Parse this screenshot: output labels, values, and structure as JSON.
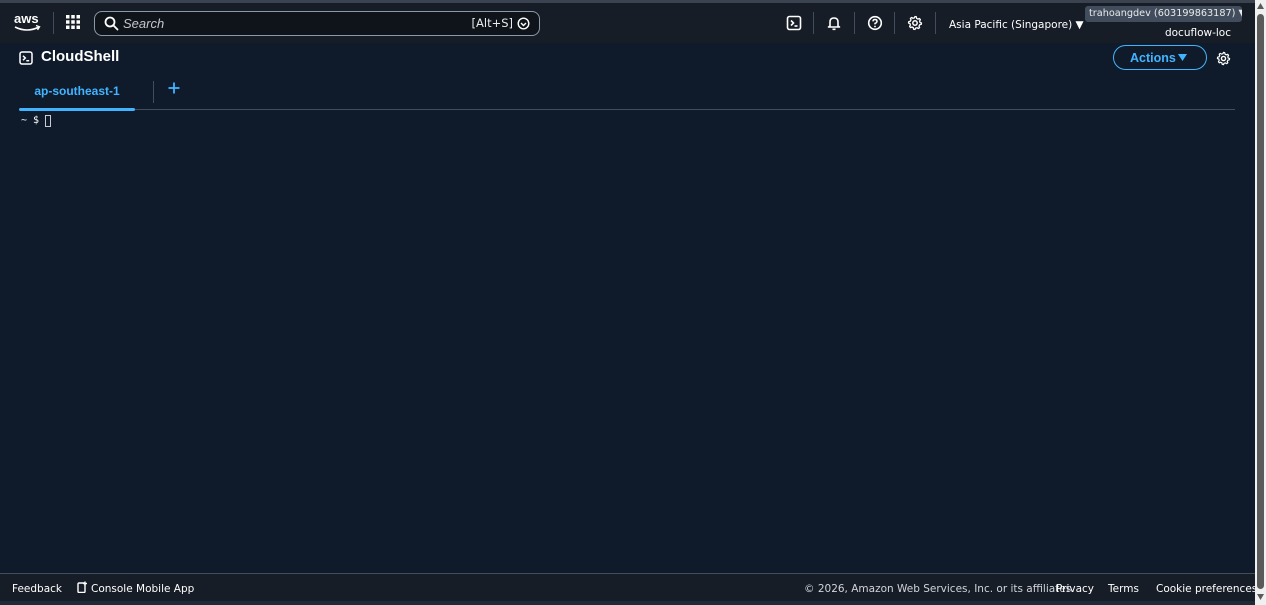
{
  "nav": {
    "logo": "aws",
    "apps_icon": "grid-icon",
    "search": {
      "placeholder": "Search",
      "shortcut": "[Alt+S]"
    },
    "icons": [
      "cloudshell-icon",
      "bell-icon",
      "help-icon",
      "gear-icon"
    ],
    "region": "Asia Pacific (Singapore) ▼",
    "account": "trahoangdev (603199863187) ▼",
    "account_alias": "docuflow-loc"
  },
  "cloudshell": {
    "title": "CloudShell",
    "actions_label": "Actions",
    "tabs": [
      {
        "label": "ap-southeast-1",
        "active": true
      }
    ]
  },
  "terminal": {
    "prompt": "~ $"
  },
  "footer": {
    "feedback": "Feedback",
    "mobile_app": "Console Mobile App",
    "copyright": "© 2026, Amazon Web Services, Inc. or its affiliates.",
    "privacy": "Privacy",
    "terms": "Terms",
    "cookies": "Cookie preferences"
  },
  "colors": {
    "nav_bg": "#161d26",
    "page_bg": "#0f1b2a",
    "accent": "#42b4ff",
    "divider": "#414d5c",
    "text": "#ffffff"
  }
}
